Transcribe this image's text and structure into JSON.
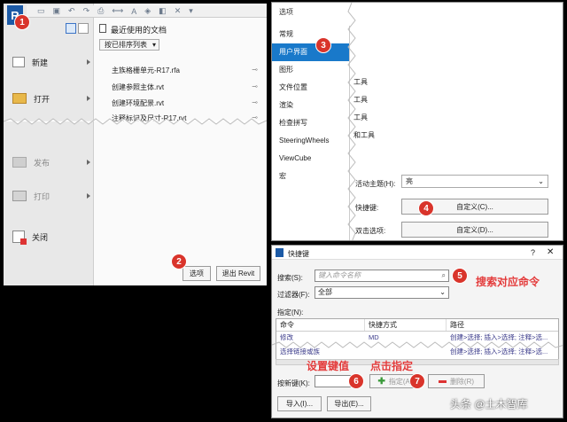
{
  "app_menu": {
    "recent_title": "最近使用的文档",
    "sort_label": "按已排序列表",
    "menu_items": [
      "新建",
      "打开",
      "发布",
      "打印",
      "关闭"
    ],
    "recent_files": [
      "主族格栅单元-R17.rfa",
      "创建参照主体.rvt",
      "创建环境配景.rvt",
      "注释标记及尺寸-R17.rvt"
    ],
    "options_button": "选项",
    "exit_button": "退出 Revit"
  },
  "options_dialog": {
    "title": "选项",
    "nav_items": [
      "常规",
      "用户界面",
      "图形",
      "文件位置",
      "渲染",
      "检查拼写",
      "SteeringWheels",
      "ViewCube",
      "宏"
    ],
    "selected_index": 1,
    "tool_lines": [
      "工具",
      "工具",
      "工具",
      "和工具"
    ],
    "theme_label": "活动主题(H):",
    "theme_value": "亮",
    "shortcut_label": "快捷键:",
    "shortcut_button": "自定义(C)...",
    "dblclick_label": "双击选项:",
    "dblclick_button": "自定义(D)..."
  },
  "shortcut_dialog": {
    "title": "快捷键",
    "search_label": "搜索(S):",
    "search_placeholder": "键入命令名称",
    "filter_label": "过滤器(F):",
    "filter_value": "全部",
    "assign_label": "指定(N):",
    "columns": [
      "命令",
      "快捷方式",
      "路径"
    ],
    "rows": [
      {
        "command": "修改",
        "shortcut": "MD",
        "path": "创建>选择; 插入>选择; 注释>选..."
      },
      {
        "command": "选择链接或族",
        "shortcut": "",
        "path": "创建>选择; 插入>选择; 注释>选..."
      }
    ],
    "newkey_label": "按新键(K):",
    "assign_button": "指定(A)",
    "remove_button": "删除(R)",
    "import_button": "导入(I)...",
    "export_button": "导出(E)..."
  },
  "annotations": {
    "search_cmd": "搜索对应命令",
    "set_key": "设置键值",
    "click_assign": "点击指定"
  },
  "badges": [
    "1",
    "2",
    "3",
    "4",
    "5",
    "6",
    "7"
  ],
  "watermark": "头条 @土木智库",
  "colors": {
    "badge": "#d9342b",
    "nav_selected": "#1979ca",
    "annotation": "#e23a3a",
    "revit_blue": "#1c5aa6"
  }
}
